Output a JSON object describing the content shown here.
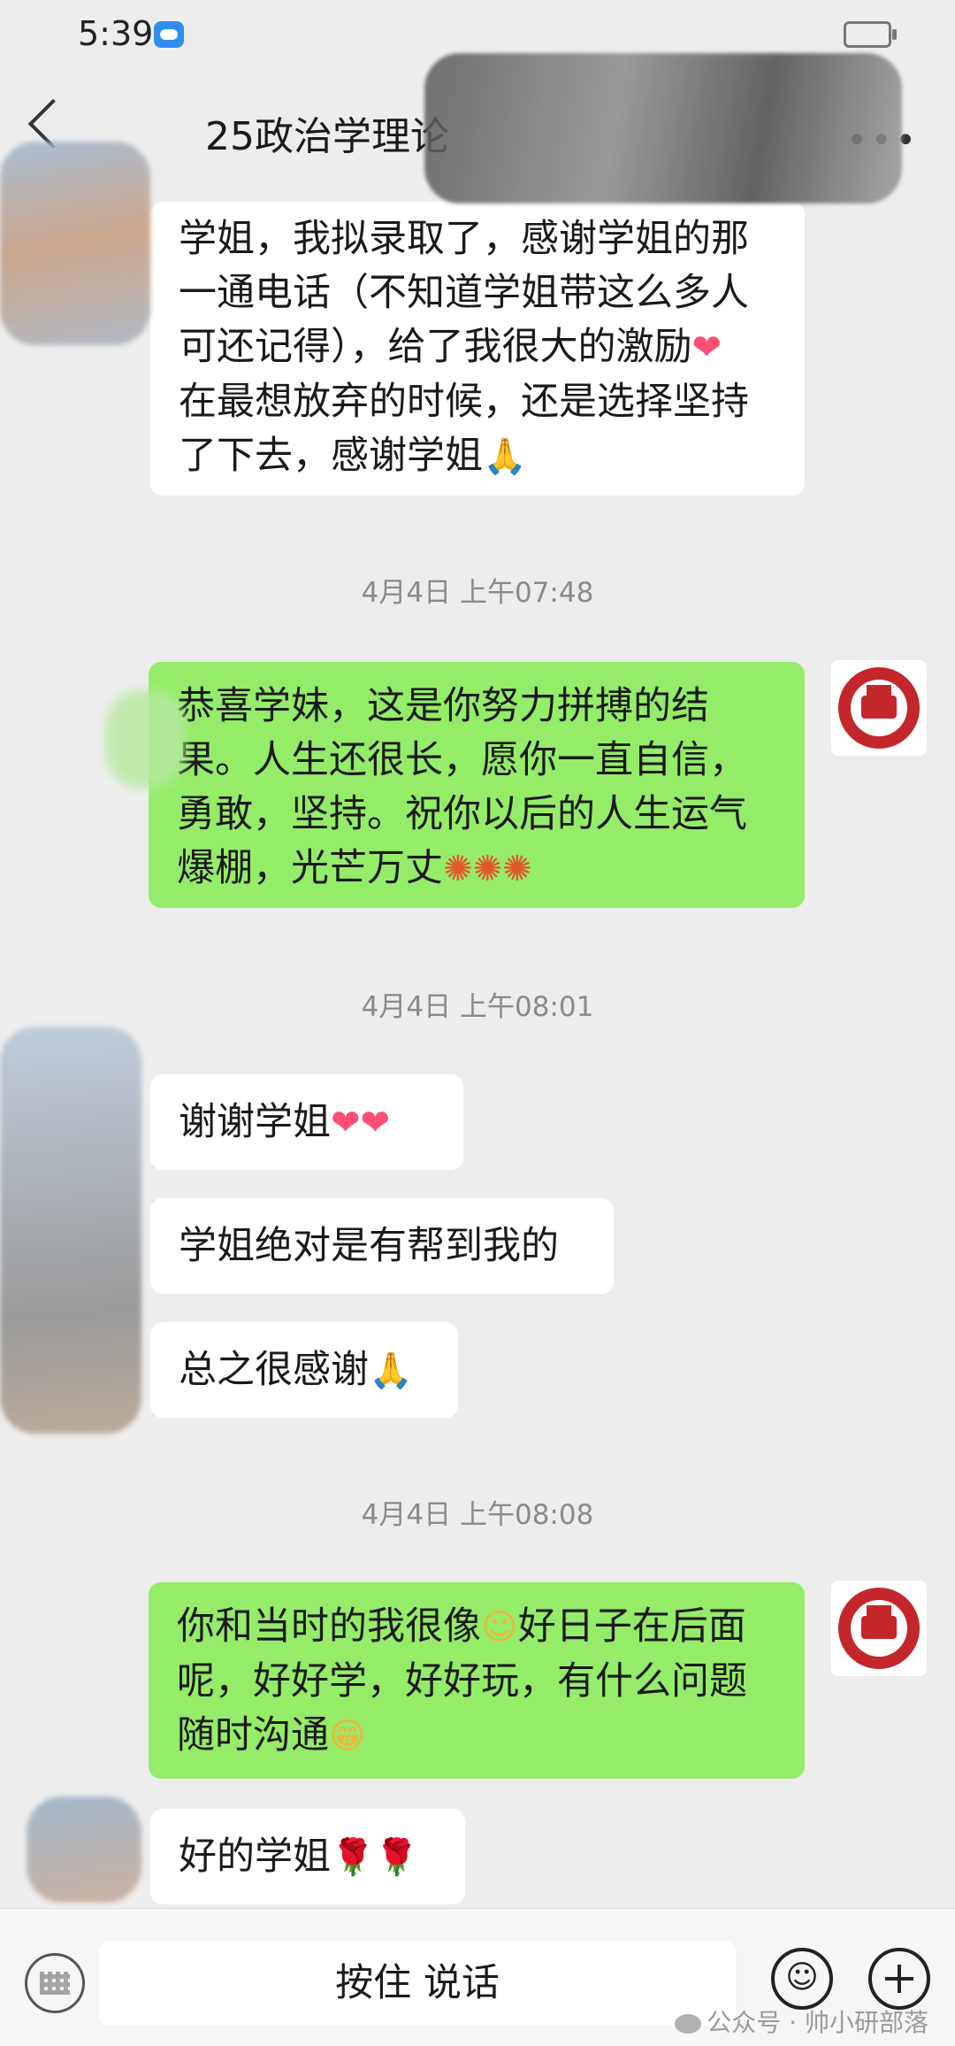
{
  "status_bar": {
    "time": "5:39"
  },
  "header": {
    "title": "25政治学理论"
  },
  "messages": [
    {
      "side": "left",
      "lines": [
        "学姐，我拟录取了，感谢学姐的那",
        "一通电话（不知道学姐带这么多人",
        "可还记得），给了我很大的激励",
        "在最想放弃的时候，还是选择坚持",
        "了下去，感谢学姐"
      ]
    },
    {
      "divider": "4月4日 上午07:48"
    },
    {
      "side": "right",
      "lines": [
        "恭喜学妹，这是你努力拼搏的结",
        "果。人生还很长，愿你一直自信，",
        "勇敢，坚持。祝你以后的人生运气",
        "爆棚，光芒万丈"
      ]
    },
    {
      "divider": "4月4日 上午08:01"
    },
    {
      "side": "left",
      "lines": [
        "谢谢学姐"
      ]
    },
    {
      "side": "left",
      "lines": [
        "学姐绝对是有帮到我的"
      ]
    },
    {
      "side": "left",
      "lines": [
        "总之很感谢"
      ]
    },
    {
      "divider": "4月4日 上午08:08"
    },
    {
      "side": "right",
      "lines": [
        "你和当时的我很像",
        "呢，好好学，好好玩，有什么问题",
        "随时沟通"
      ]
    },
    {
      "side": "left",
      "lines": [
        "好的学姐"
      ]
    }
  ],
  "msg": {
    "m1": {
      "l1": "学姐，我拟录取了，感谢学姐的那",
      "l2": "一通电话（不知道学姐带这么多人",
      "l3": "可还记得），给了我很大的激励",
      "l4": "在最想放弃的时候，还是选择坚持",
      "l5": "了下去，感谢学姐"
    },
    "d1": "4月4日 上午07:48",
    "m2": {
      "l1": "恭喜学妹，这是你努力拼搏的结",
      "l2": "果。人生还很长，愿你一直自信，",
      "l3": "勇敢，坚持。祝你以后的人生运气",
      "l4": "爆棚，光芒万丈"
    },
    "d2": "4月4日 上午08:01",
    "m3": "谢谢学姐",
    "m4": "学姐绝对是有帮到我的",
    "m5": "总之很感谢",
    "d3": "4月4日 上午08:08",
    "m6": {
      "l1a": "你和当时的我很像",
      "l1b": "好日子在后面",
      "l2": "呢，好好学，好好玩，有什么问题",
      "l3": "随时沟通"
    },
    "m7": "好的学姐"
  },
  "icons": {
    "heart": "❤",
    "pray": "🙏",
    "fireworks": "✺",
    "smile": "☺",
    "grin": "😁",
    "rose": "🌹"
  },
  "input": {
    "hold_to_talk": "按住 说话",
    "emoji_button": "☺"
  },
  "watermark": "公众号 · 帅小研部落"
}
